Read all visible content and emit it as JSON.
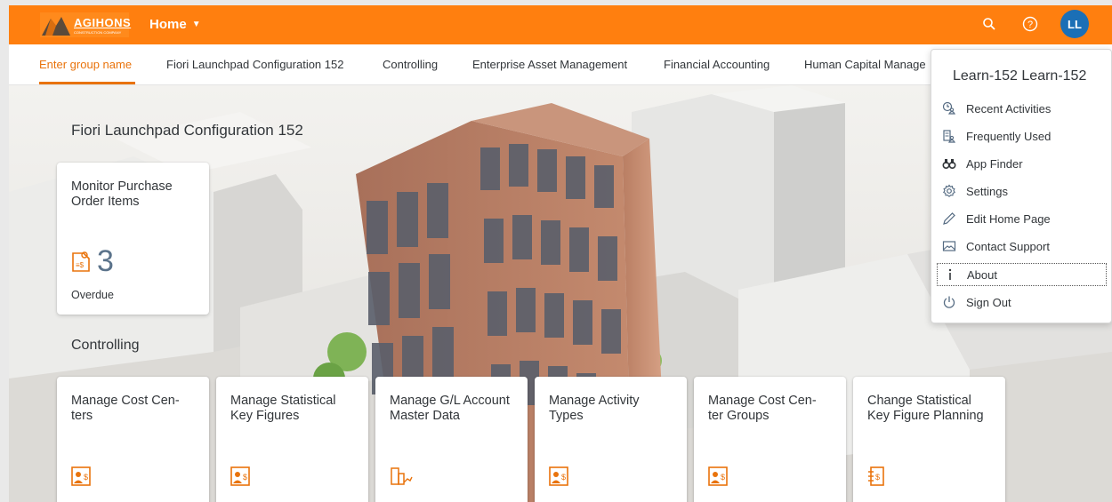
{
  "shell": {
    "logo_text": "AGIHONS",
    "logo_sub": "CONSTRUCTION COMPANY",
    "home_label": "Home",
    "avatar_initials": "LL",
    "colors": {
      "shell": "#ff7f0f",
      "avatar": "#1b6fb6",
      "accent": "#e9730c"
    }
  },
  "tabs": [
    {
      "label": "Enter group name"
    },
    {
      "label": "Fiori Launchpad Configuration 152"
    },
    {
      "label": "Controlling"
    },
    {
      "label": "Enterprise Asset Management"
    },
    {
      "label": "Financial Accounting"
    },
    {
      "label": "Human Capital Manage"
    }
  ],
  "sections": {
    "fiori": {
      "title": "Fiori Launchpad Configuration 152",
      "tile": {
        "title": "Monitor Purchase Order Items",
        "value": "3",
        "footer": "Overdue"
      }
    },
    "controlling": {
      "title": "Controlling",
      "tiles": [
        {
          "title": "Manage Cost Cen- ters",
          "icon": "cost-center-icon"
        },
        {
          "title": "Manage Statistical Key Figures",
          "icon": "cost-center-icon"
        },
        {
          "title": "Manage G/L Account Master Data",
          "icon": "building-chart-icon"
        },
        {
          "title": "Manage Activity Types",
          "icon": "cost-center-icon"
        },
        {
          "title": "Manage Cost Cen- ter Groups",
          "icon": "cost-center-icon"
        },
        {
          "title": "Change Statistical Key Figure Planning",
          "icon": "planning-doc-icon"
        }
      ]
    }
  },
  "menu": {
    "user": "Learn-152 Learn-152",
    "items": [
      {
        "label": "Recent Activities",
        "icon": "recent-activities-icon"
      },
      {
        "label": "Frequently Used",
        "icon": "frequently-used-icon"
      },
      {
        "label": "App Finder",
        "icon": "binoculars-icon"
      },
      {
        "label": "Settings",
        "icon": "gear-icon"
      },
      {
        "label": "Edit Home Page",
        "icon": "pencil-icon"
      },
      {
        "label": "Contact Support",
        "icon": "envelope-icon"
      },
      {
        "label": "About",
        "icon": "info-icon"
      },
      {
        "label": "Sign Out",
        "icon": "power-icon"
      }
    ]
  }
}
